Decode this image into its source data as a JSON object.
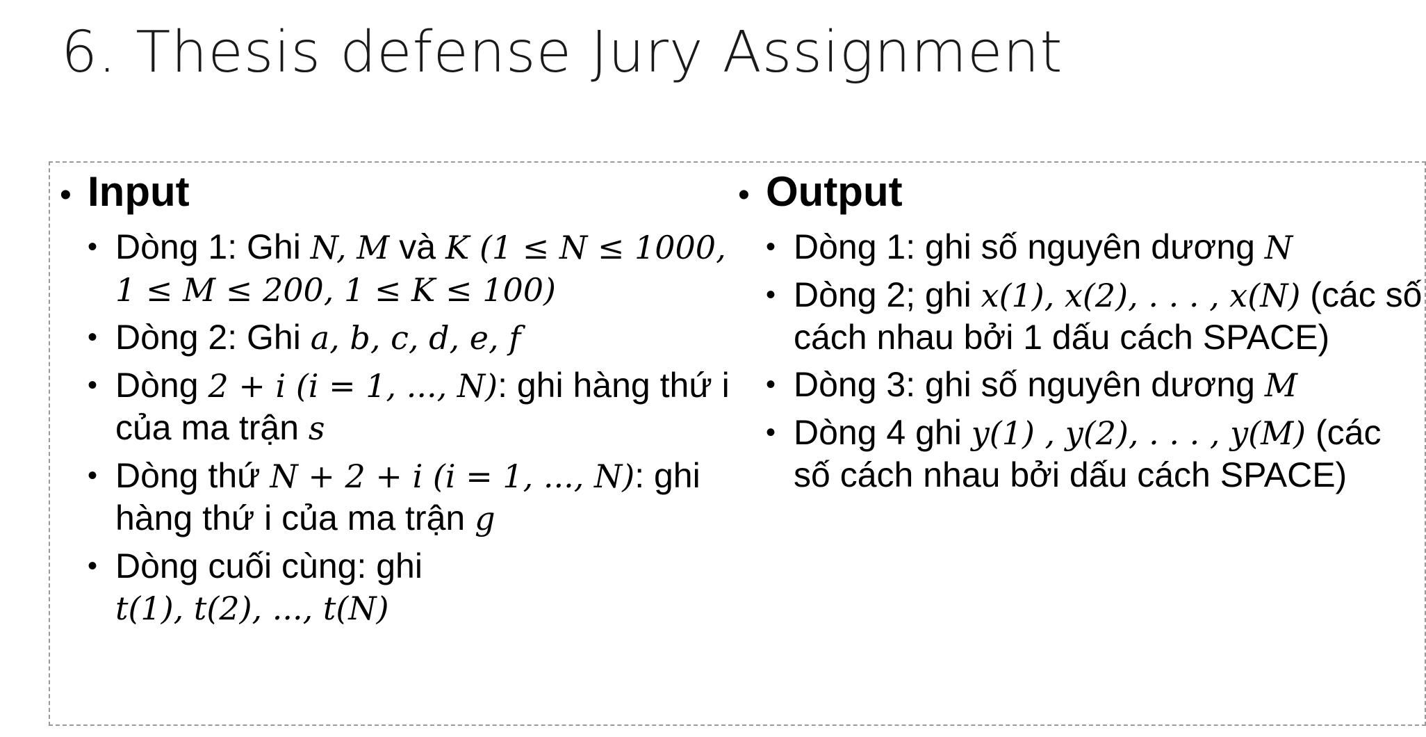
{
  "slide": {
    "title": "6. Thesis defense Jury Assignment"
  },
  "input": {
    "heading": "Input",
    "items": [
      {
        "t1": "Dòng 1: Ghi ",
        "m1": "N, M",
        "t2": " và ",
        "m2": "K",
        "m3": " (1 ≤ N ≤ 1000, 1 ≤ M ≤ 200, 1 ≤ K ≤ 100)"
      },
      {
        "t1": "Dòng 2: Ghi ",
        "m1": "a, b, c, d, e, f"
      },
      {
        "t1": "Dòng ",
        "m1": "2 + i (i = 1, ..., N)",
        "t2": ": ghi hàng thứ i của ma trận ",
        "m2": "s"
      },
      {
        "t1": "Dòng thứ ",
        "m1": "N + 2 + i (i = 1, ..., N)",
        "t2": ": ghi hàng thứ i của ma trận ",
        "m2": "g"
      },
      {
        "t1": "Dòng cuối cùng: ghi ",
        "m1": "t(1), t(2), ..., t(N)"
      }
    ]
  },
  "output": {
    "heading": "Output",
    "items": [
      {
        "t1": "Dòng 1: ghi số nguyên dương ",
        "m1": "N"
      },
      {
        "t1": "Dòng 2; ghi ",
        "m1": "x(1), x(2), . . . , x(N)",
        "t2": " (các số cách nhau bởi 1 dấu cách SPACE)"
      },
      {
        "t1": "Dòng 3: ghi số nguyên dương ",
        "m1": "M"
      },
      {
        "t1": "Dòng 4 ghi ",
        "m1": "y(1) , y(2), . . . , y(M)",
        "t2": " (các số cách nhau bởi dấu cách SPACE)"
      }
    ]
  }
}
